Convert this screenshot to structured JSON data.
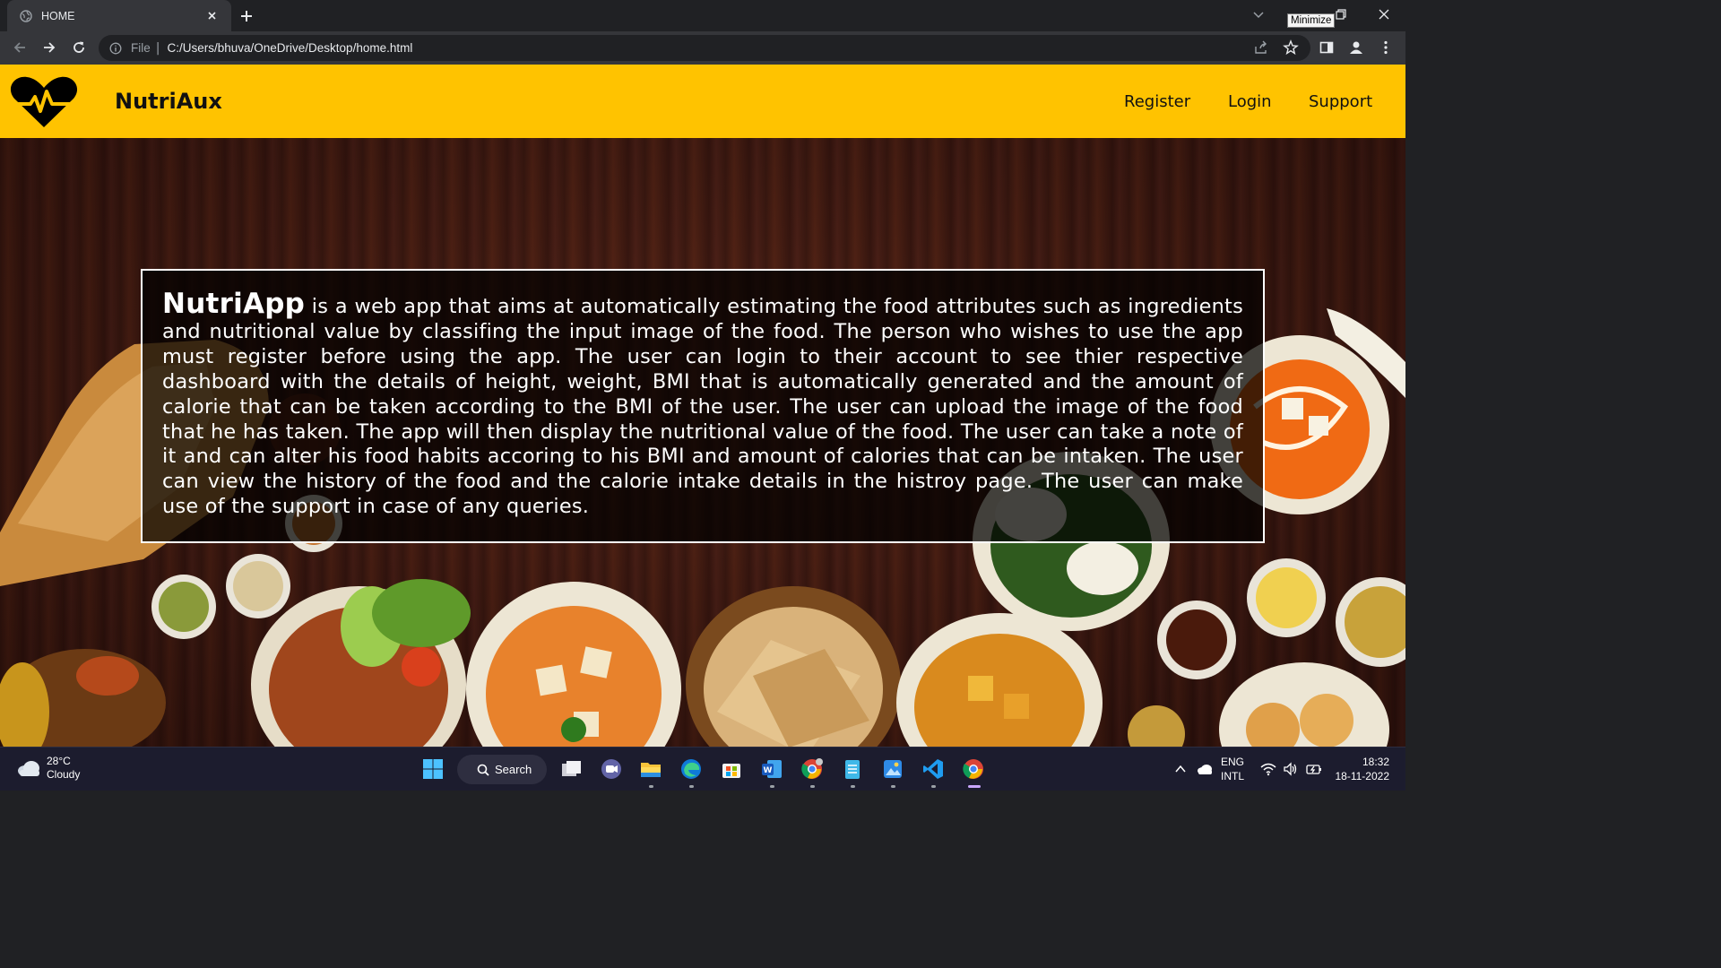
{
  "browser": {
    "tab_title": "HOME",
    "url_scheme": "File",
    "url": "C:/Users/bhuva/OneDrive/Desktop/home.html",
    "tooltip": "Minimize"
  },
  "navbar": {
    "brand": "NutriAux",
    "links": [
      "Register",
      "Login",
      "Support"
    ],
    "accent_color": "#ffc300"
  },
  "hero": {
    "app_name": "NutriApp",
    "description": " is a web app that aims at automatically estimating the food attributes such as ingredients and nutritional value by classifing the input image of the food. The person who wishes to use the app must register before using the app. The user can login to their account to see thier respective dashboard with the details of height, weight, BMI that is automatically generated and the amount of calorie that can be taken according to the BMI of the user. The user can upload the image of the food that he has taken. The app will then display the nutritional value of the food. The user can take a note of it and can alter his food habits accoring to his BMI and amount of calories that can be intaken. The user can view the history of the food and the calorie intake details in the histroy page. The user can make use of the support in case of any queries."
  },
  "taskbar": {
    "weather_temp": "28°C",
    "weather_desc": "Cloudy",
    "search_label": "Search",
    "lang_top": "ENG",
    "lang_bottom": "INTL",
    "time": "18:32",
    "date": "18-11-2022"
  }
}
